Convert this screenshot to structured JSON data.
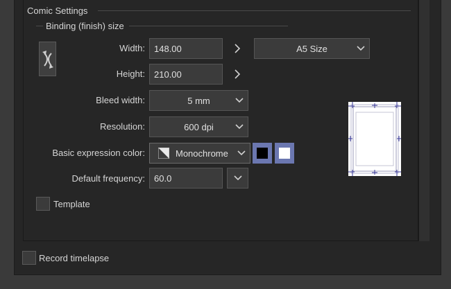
{
  "group": {
    "title": "Comic Settings",
    "subgroup_title": "Binding (finish) size"
  },
  "fields": {
    "width": {
      "label": "Width:",
      "value": "148.00"
    },
    "height": {
      "label": "Height:",
      "value": "210.00"
    },
    "size_preset": {
      "value": "A5 Size"
    },
    "bleed": {
      "label": "Bleed width:",
      "value": "5 mm"
    },
    "resolution": {
      "label": "Resolution:",
      "value": "600 dpi"
    },
    "expression_color": {
      "label": "Basic expression color:",
      "value": "Monochrome"
    },
    "frequency": {
      "label": "Default frequency:",
      "value": "60.0"
    }
  },
  "checkboxes": {
    "template": {
      "label": "Template",
      "checked": false
    },
    "timelapse": {
      "label": "Record timelapse",
      "checked": false
    }
  },
  "colors": {
    "black_swatch": "#000000",
    "white_swatch": "#ffffff",
    "swatch_frame": "#6b77b0"
  },
  "icons": {
    "swap": "swap-orientation-icon",
    "chevron_right": "chevron-right-icon",
    "chevron_down": "chevron-down-icon",
    "monochrome": "monochrome-icon"
  }
}
